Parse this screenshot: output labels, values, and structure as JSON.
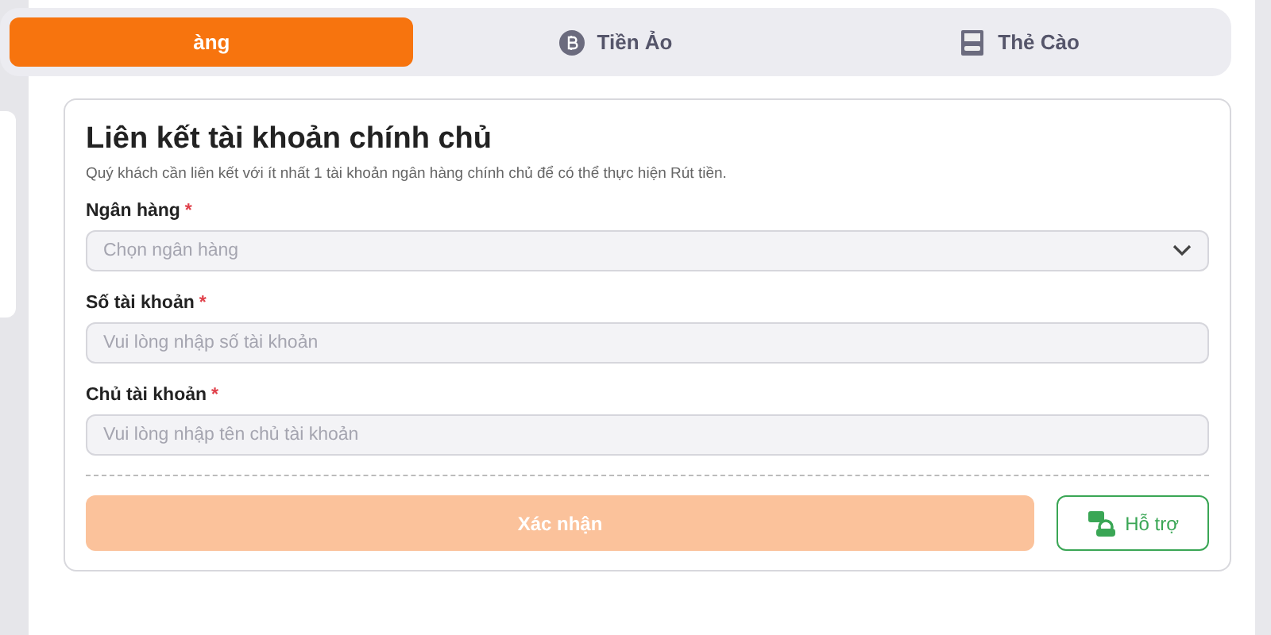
{
  "tabs": [
    {
      "label": "àng",
      "kind": "plain",
      "selected": true
    },
    {
      "label": "Tiền Ảo",
      "kind": "crypto",
      "selected": false
    },
    {
      "label": "Thẻ Cào",
      "kind": "card",
      "selected": false
    }
  ],
  "form": {
    "title": "Liên kết tài khoản chính chủ",
    "description": "Quý khách cần liên kết với ít nhất 1 tài khoản ngân hàng chính chủ để có thể thực hiện Rút tiền.",
    "fields": [
      {
        "label": "Ngân hàng",
        "required_mark": "*",
        "kind": "select",
        "placeholder": "Chọn ngân hàng"
      },
      {
        "label": "Số tài khoản",
        "required_mark": "*",
        "kind": "text",
        "placeholder": "Vui lòng nhập số tài khoản"
      },
      {
        "label": "Chủ tài khoản",
        "required_mark": "*",
        "kind": "text",
        "placeholder": "Vui lòng nhập tên chủ tài khoản"
      }
    ],
    "submit": {
      "label": "Xác nhận",
      "disabled": true
    },
    "support": {
      "label": "Hỗ trợ"
    }
  }
}
